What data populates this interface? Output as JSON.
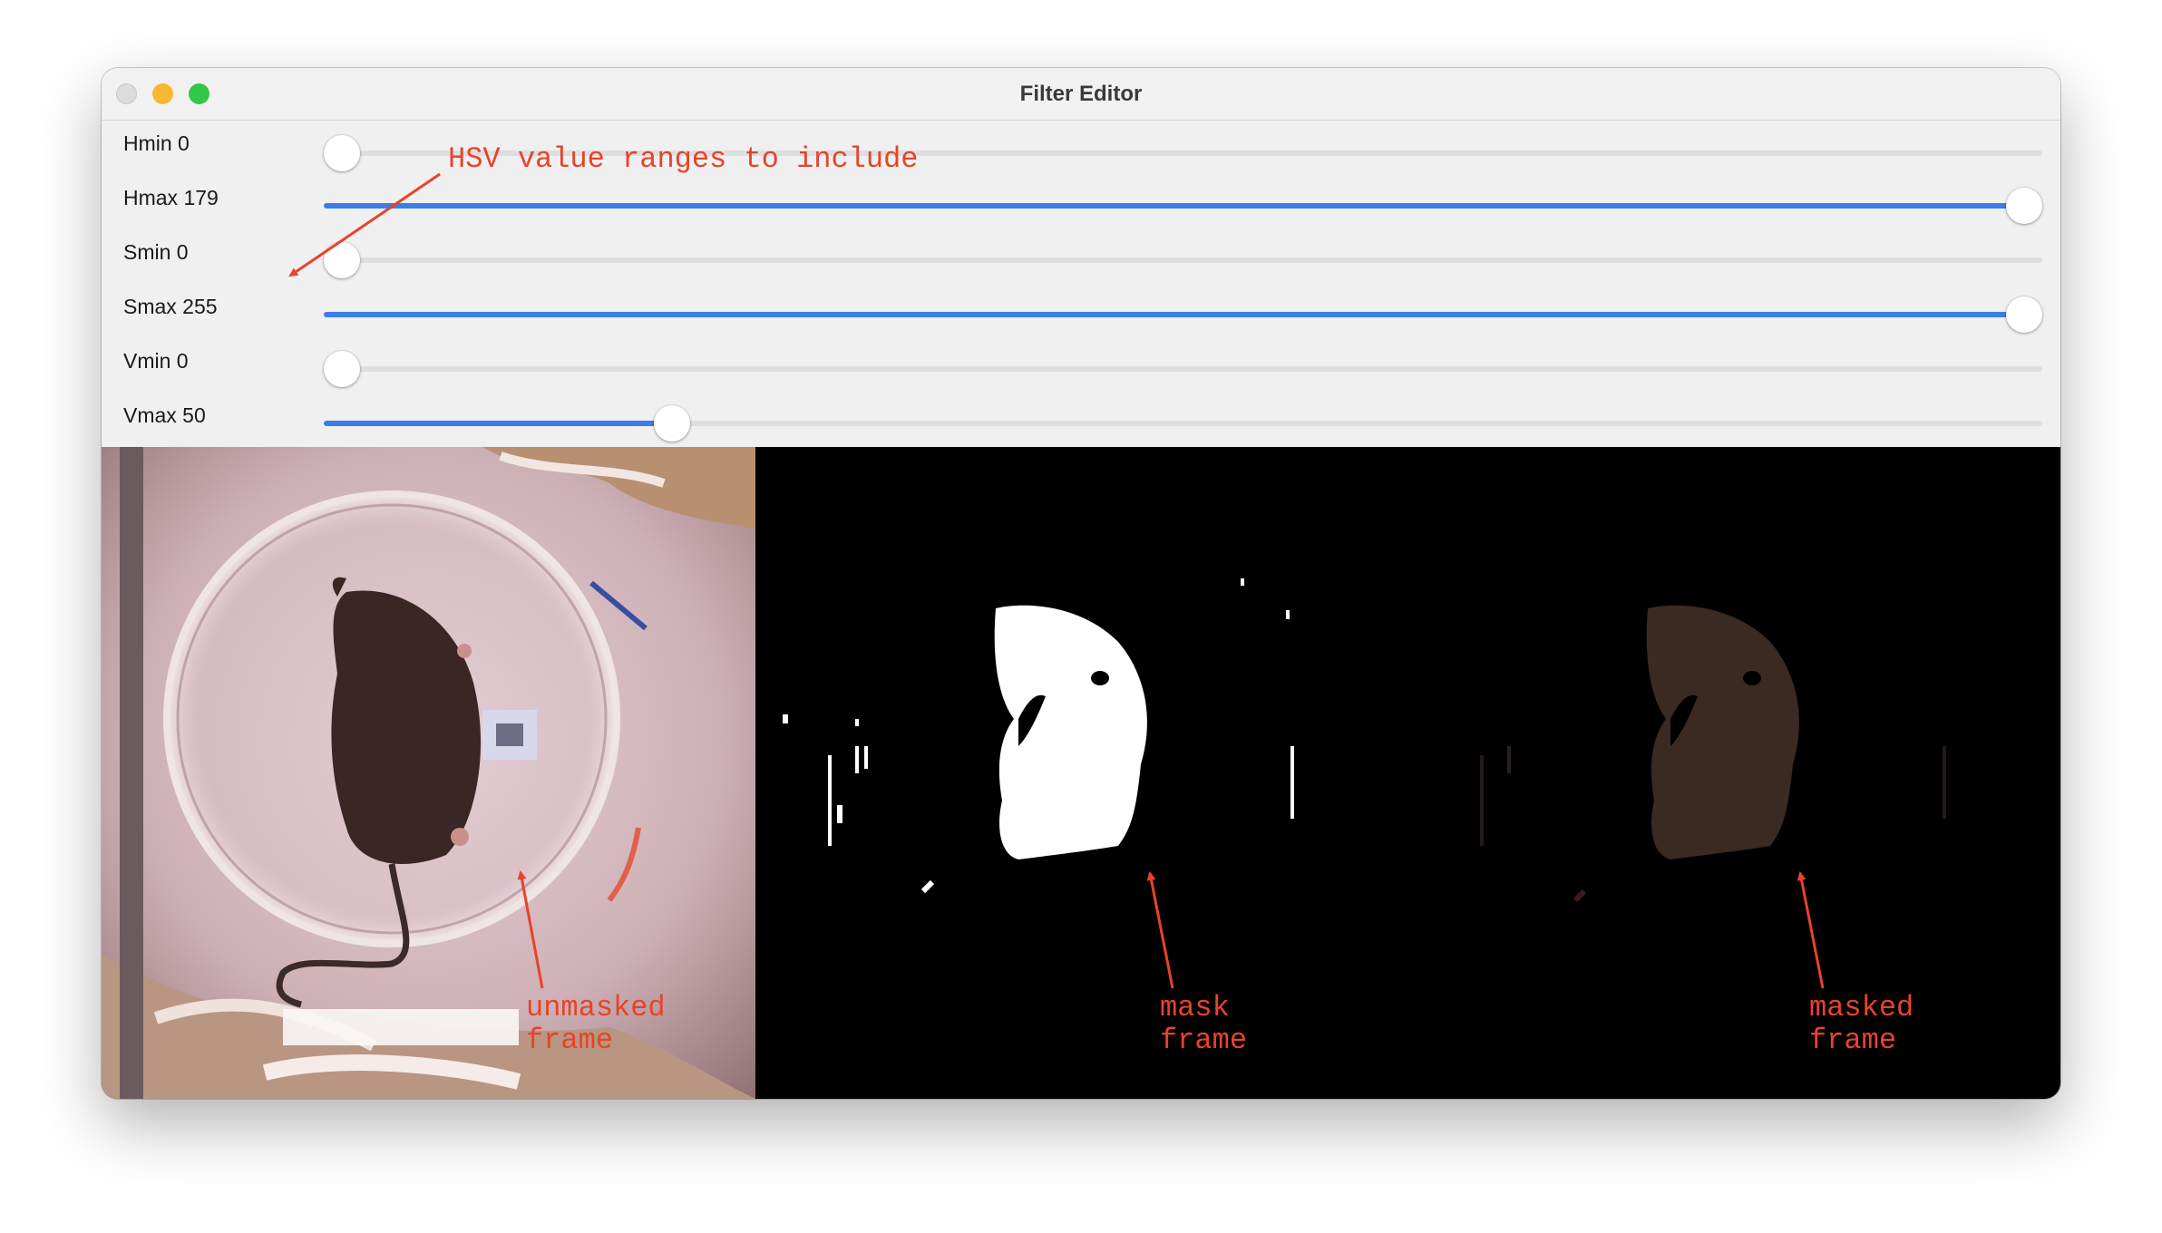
{
  "window": {
    "title": "Filter Editor"
  },
  "sliders": [
    {
      "label": "Hmin 0",
      "value": 0,
      "max": 179
    },
    {
      "label": "Hmax 179",
      "value": 179,
      "max": 179
    },
    {
      "label": "Smin 0",
      "value": 0,
      "max": 255
    },
    {
      "label": "Smax 255",
      "value": 255,
      "max": 255
    },
    {
      "label": "Vmin 0",
      "value": 0,
      "max": 255
    },
    {
      "label": "Vmax 50",
      "value": 50,
      "max": 255
    }
  ],
  "annotations": {
    "hsv_note": "HSV value ranges to include",
    "unmasked": "unmasked\nframe",
    "mask": "mask\nframe",
    "masked": "masked\nframe"
  },
  "colors": {
    "accent": "#3b7de9",
    "annotation": "#e8432a"
  }
}
